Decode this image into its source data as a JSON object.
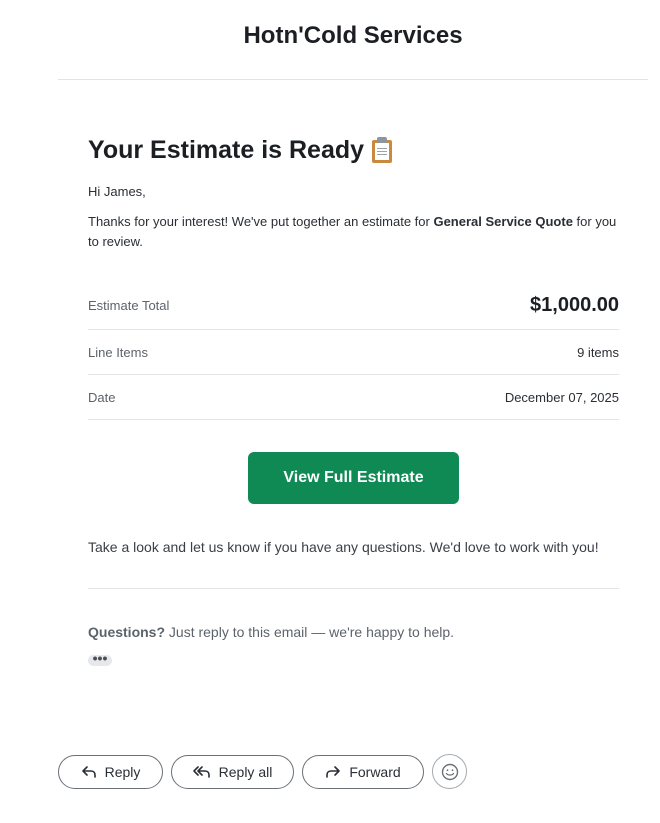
{
  "header": {
    "company_name": "Hotn'Cold Services"
  },
  "email": {
    "title": "Your Estimate is Ready",
    "title_icon": "clipboard-icon",
    "greeting": "Hi James,",
    "intro_before": "Thanks for your interest! We've put together an estimate for ",
    "intro_bold": "General Service Quote",
    "intro_after": " for you to review.",
    "summary": {
      "total_label": "Estimate Total",
      "total_value": "$1,000.00",
      "items_label": "Line Items",
      "items_value": "9 items",
      "date_label": "Date",
      "date_value": "December 07, 2025"
    },
    "cta_label": "View Full Estimate",
    "closing": "Take a look and let us know if you have any questions. We'd love to work with you!",
    "questions_bold": "Questions?",
    "questions_text": " Just reply to this email — we're happy to help.",
    "ellipsis": "•••"
  },
  "actions": {
    "reply_label": "Reply",
    "reply_all_label": "Reply all",
    "forward_label": "Forward",
    "emoji_icon": "smiley-icon"
  },
  "colors": {
    "cta_bg": "#0f8a55",
    "divider": "#e3e5e8"
  }
}
